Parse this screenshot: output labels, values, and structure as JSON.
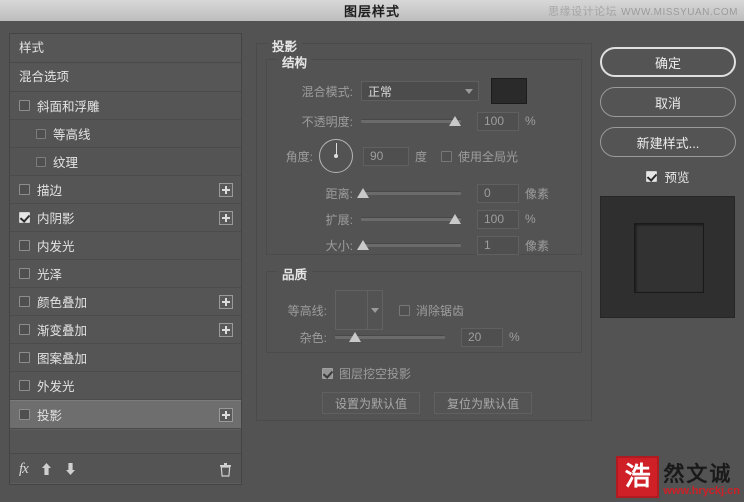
{
  "window": {
    "title": "图层样式",
    "watermark_top_cn": "思缘设计论坛",
    "watermark_top_url": "WWW.MISSYUAN.COM"
  },
  "sidebar": {
    "header": "样式",
    "blending_options": "混合选项",
    "items": [
      {
        "label": "斜面和浮雕",
        "checked": false,
        "indent": false,
        "plus": false,
        "selected": false
      },
      {
        "label": "等高线",
        "checked": false,
        "indent": true,
        "plus": false,
        "selected": false
      },
      {
        "label": "纹理",
        "checked": false,
        "indent": true,
        "plus": false,
        "selected": false
      },
      {
        "label": "描边",
        "checked": false,
        "indent": false,
        "plus": true,
        "selected": false
      },
      {
        "label": "内阴影",
        "checked": true,
        "indent": false,
        "plus": true,
        "selected": false
      },
      {
        "label": "内发光",
        "checked": false,
        "indent": false,
        "plus": false,
        "selected": false
      },
      {
        "label": "光泽",
        "checked": false,
        "indent": false,
        "plus": false,
        "selected": false
      },
      {
        "label": "颜色叠加",
        "checked": false,
        "indent": false,
        "plus": true,
        "selected": false
      },
      {
        "label": "渐变叠加",
        "checked": false,
        "indent": false,
        "plus": true,
        "selected": false
      },
      {
        "label": "图案叠加",
        "checked": false,
        "indent": false,
        "plus": false,
        "selected": false
      },
      {
        "label": "外发光",
        "checked": false,
        "indent": false,
        "plus": false,
        "selected": false
      },
      {
        "label": "投影",
        "checked": false,
        "indent": false,
        "plus": true,
        "selected": true
      }
    ],
    "footer": {
      "fx_label": "fx",
      "move_up": "上移效果",
      "move_down": "下移效果",
      "delete": "删除效果"
    }
  },
  "main": {
    "section_title": "投影",
    "structure": {
      "legend": "结构",
      "blend_mode_label": "混合模式:",
      "blend_mode_value": "正常",
      "shadow_color": "#2a2a2a",
      "opacity_label": "不透明度:",
      "opacity_value": "100",
      "opacity_unit": "%",
      "angle_label": "角度:",
      "angle_value": "90",
      "angle_unit": "度",
      "angle_degrees": 90,
      "use_global_light": "使用全局光",
      "use_global_light_checked": false,
      "distance_label": "距离:",
      "distance_value": "0",
      "distance_unit": "像素",
      "spread_label": "扩展:",
      "spread_value": "100",
      "spread_unit": "%",
      "size_label": "大小:",
      "size_value": "1",
      "size_unit": "像素"
    },
    "quality": {
      "legend": "品质",
      "contour_label": "等高线:",
      "anti_alias_label": "消除锯齿",
      "anti_alias_checked": false,
      "noise_label": "杂色:",
      "noise_value": "20",
      "noise_unit": "%"
    },
    "footer": {
      "knockout_label": "图层挖空投影",
      "knockout_checked": true,
      "set_default": "设置为默认值",
      "reset_default": "复位为默认值"
    }
  },
  "right": {
    "ok": "确定",
    "cancel": "取消",
    "new_style": "新建样式...",
    "preview_label": "预览",
    "preview_checked": true
  },
  "watermark_logo": {
    "seal": "浩",
    "name": "然文诚",
    "url": "www.hryckj.cn"
  }
}
